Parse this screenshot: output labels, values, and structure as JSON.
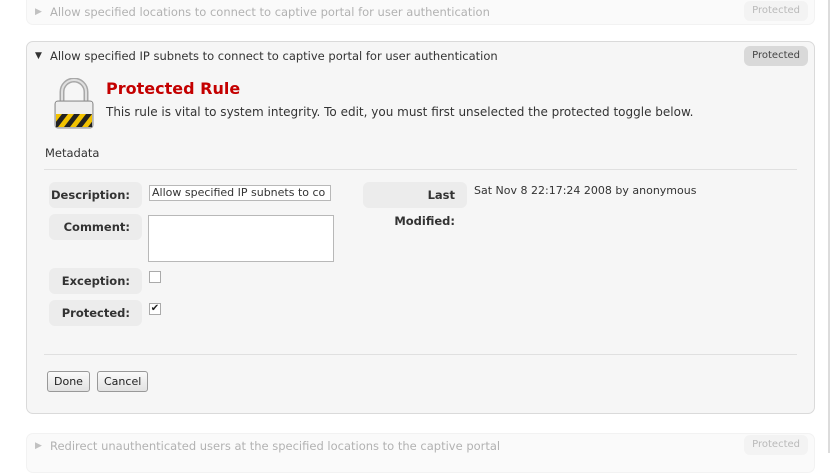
{
  "rules": [
    {
      "title": "Allow specified locations to connect to captive portal for user authentication",
      "badge": "Protected"
    },
    {
      "title": "Allow specified IP subnets to connect to captive portal for user authentication",
      "badge": "Protected"
    },
    {
      "title": "Redirect unauthenticated users at the specified locations to the captive portal",
      "badge": "Protected"
    }
  ],
  "protected_notice": {
    "title": "Protected Rule",
    "text": "This rule is vital to system integrity. To edit, you must first unselected the protected toggle below."
  },
  "metadata_label": "Metadata",
  "fields": {
    "description_label": "Description:",
    "description_value": "Allow specified IP subnets to co",
    "comment_label": "Comment:",
    "comment_value": "",
    "exception_label": "Exception:",
    "exception_checked": false,
    "protected_label": "Protected:",
    "protected_checked": true,
    "last_modified_label": "Last Modified:",
    "last_modified_value": "Sat Nov 8 22:17:24 2008 by anonymous"
  },
  "buttons": {
    "done": "Done",
    "cancel": "Cancel"
  },
  "colors": {
    "protected_title": "#c40000",
    "panel_bg": "#f6f6f6",
    "label_bg": "#ececec"
  },
  "icons": {
    "lock": "padlock-warning-icon",
    "expanded": "triangle-down-icon",
    "collapsed": "triangle-right-icon"
  }
}
